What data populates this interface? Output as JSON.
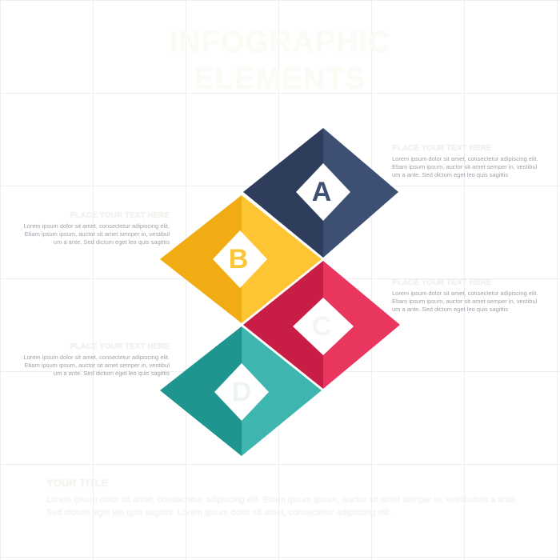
{
  "title": {
    "line1": "INFOGRAPHIC",
    "line2": "ELEMENTS"
  },
  "items": [
    {
      "letter": "A",
      "heading": "PLACE YOUR TEXT HERE",
      "body": "Lorem ipsum dolor sit amet, consectetur adipiscing elit. Etiam ipsum ipsum, auctor sit amet semper in, vestibul um a ante. Sed dictum eget leo quis sagittis",
      "color_dark": "#2e3d5c",
      "color_light": "#3d4f73"
    },
    {
      "letter": "B",
      "heading": "PLACE YOUR TEXT HERE",
      "body": "Lorem ipsum dolor sit amet, consectetur adipiscing elit. Etiam ipsum ipsum, auctor sit amet semper in, vestibul um a ante. Sed dictum eget leo quis sagittis",
      "color_dark": "#f0ac12",
      "color_light": "#fdc533"
    },
    {
      "letter": "C",
      "heading": "PLACE YOUR TEXT HERE",
      "body": "Lorem ipsum dolor sit amet, consectetur adipiscing elit. Etiam ipsum ipsum, auctor sit amet semper in, vestibul um a ante. Sed dictum eget leo quis sagittis",
      "color_dark": "#c81d45",
      "color_light": "#e8365f"
    },
    {
      "letter": "D",
      "heading": "PLACE YOUR TEXT HERE",
      "body": "Lorem ipsum dolor sit amet, consectetur adipiscing elit. Etiam ipsum ipsum, auctor sit amet semper in, vestibul um a ante. Sed dictum eget leo quis sagittis",
      "color_dark": "#1e958e",
      "color_light": "#3eb5ae"
    }
  ],
  "footer": {
    "heading": "YOUR TITLE",
    "body": "Lorem ipsum dolor sit amet, consectetur adipiscing elit. Etiam ipsum ipsum, auctor sit amet semper in, vestibulum a ante. Sed dictum eget leo quis sagittis. Lorem ipsum dolor sit amet, consectetur adipiscing elit."
  }
}
